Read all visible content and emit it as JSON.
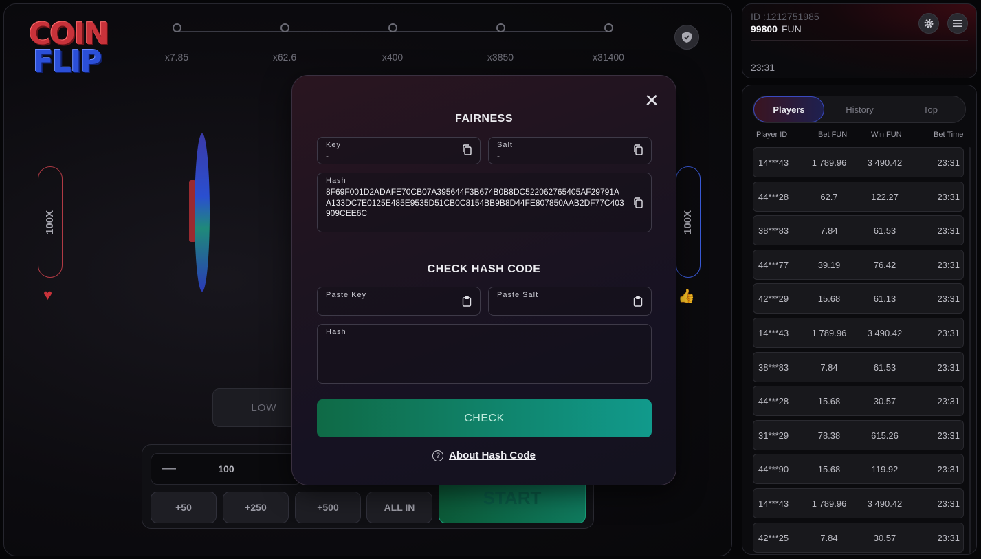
{
  "game": {
    "logo_line1": "COIN",
    "logo_line2": "FLIP",
    "multipliers": [
      "x7.85",
      "x62.6",
      "x400",
      "x3850",
      "x31400"
    ],
    "left_pill": "100X",
    "right_pill": "100X",
    "low_label": "LOW",
    "bet_value": "100",
    "minus_label": "—",
    "quick_bets": [
      "+50",
      "+250",
      "+500",
      "ALL IN"
    ],
    "start_label": "START"
  },
  "modal": {
    "title": "FAIRNESS",
    "key_label": "Key",
    "key_value": "-",
    "salt_label": "Salt",
    "salt_value": "-",
    "hash_label": "Hash",
    "hash_value": "8F69F001D2ADAFE70CB07A395644F3B674B0B8DC522062765405AF29791AA133DC7E0125E485E9535D51CB0C8154BB9B8D44FE807850AAB2DF77C403909CEE6C",
    "check_title": "CHECK HASH CODE",
    "paste_key_label": "Paste Key",
    "paste_salt_label": "Paste Salt",
    "check_hash_label": "Hash",
    "check_button": "CHECK",
    "about_link": "About Hash Code",
    "close_icon": "close-icon"
  },
  "account": {
    "id": "ID :1212751985",
    "balance": "99800",
    "currency": "FUN",
    "time": "23:31"
  },
  "sidebar": {
    "tabs": [
      "Players",
      "History",
      "Top"
    ],
    "active_tab": "Players",
    "columns": [
      "Player ID",
      "Bet  FUN",
      "Win  FUN",
      "Bet Time"
    ],
    "rows": [
      {
        "id": "14***43",
        "bet": "1 789.96",
        "win": "3 490.42",
        "time": "23:31"
      },
      {
        "id": "44***28",
        "bet": "62.7",
        "win": "122.27",
        "time": "23:31"
      },
      {
        "id": "38***83",
        "bet": "7.84",
        "win": "61.53",
        "time": "23:31"
      },
      {
        "id": "44***77",
        "bet": "39.19",
        "win": "76.42",
        "time": "23:31"
      },
      {
        "id": "42***29",
        "bet": "15.68",
        "win": "61.13",
        "time": "23:31"
      },
      {
        "id": "14***43",
        "bet": "1 789.96",
        "win": "3 490.42",
        "time": "23:31"
      },
      {
        "id": "38***83",
        "bet": "7.84",
        "win": "61.53",
        "time": "23:31"
      },
      {
        "id": "44***28",
        "bet": "15.68",
        "win": "30.57",
        "time": "23:31"
      },
      {
        "id": "31***29",
        "bet": "78.38",
        "win": "615.26",
        "time": "23:31"
      },
      {
        "id": "44***90",
        "bet": "15.68",
        "win": "119.92",
        "time": "23:31"
      },
      {
        "id": "14***43",
        "bet": "1 789.96",
        "win": "3 490.42",
        "time": "23:31"
      },
      {
        "id": "42***25",
        "bet": "7.84",
        "win": "30.57",
        "time": "23:31"
      }
    ]
  },
  "colors": {
    "accent_red": "#c8323a",
    "accent_blue": "#2b4fd8",
    "check_green": "#0f7a5e"
  }
}
